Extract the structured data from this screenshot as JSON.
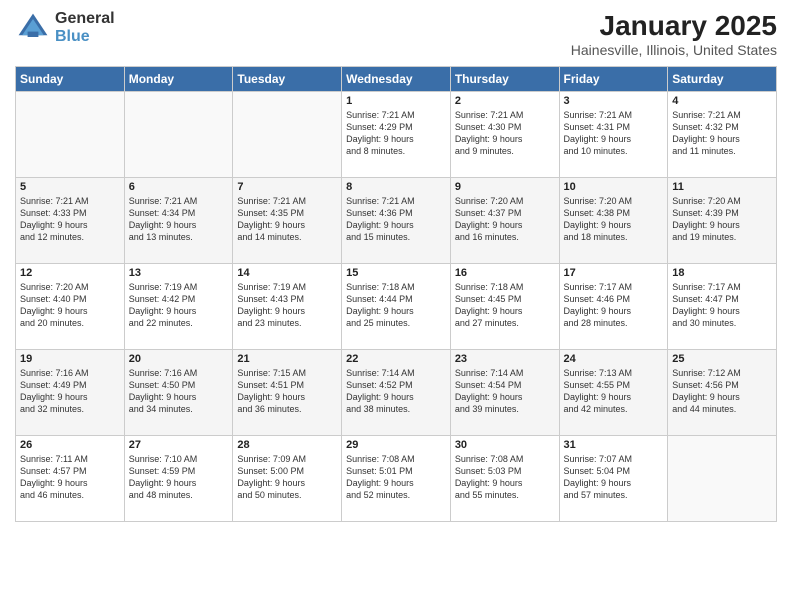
{
  "logo": {
    "line1": "General",
    "line2": "Blue"
  },
  "title": "January 2025",
  "subtitle": "Hainesville, Illinois, United States",
  "headers": [
    "Sunday",
    "Monday",
    "Tuesday",
    "Wednesday",
    "Thursday",
    "Friday",
    "Saturday"
  ],
  "weeks": [
    [
      {
        "day": "",
        "info": ""
      },
      {
        "day": "",
        "info": ""
      },
      {
        "day": "",
        "info": ""
      },
      {
        "day": "1",
        "info": "Sunrise: 7:21 AM\nSunset: 4:29 PM\nDaylight: 9 hours\nand 8 minutes."
      },
      {
        "day": "2",
        "info": "Sunrise: 7:21 AM\nSunset: 4:30 PM\nDaylight: 9 hours\nand 9 minutes."
      },
      {
        "day": "3",
        "info": "Sunrise: 7:21 AM\nSunset: 4:31 PM\nDaylight: 9 hours\nand 10 minutes."
      },
      {
        "day": "4",
        "info": "Sunrise: 7:21 AM\nSunset: 4:32 PM\nDaylight: 9 hours\nand 11 minutes."
      }
    ],
    [
      {
        "day": "5",
        "info": "Sunrise: 7:21 AM\nSunset: 4:33 PM\nDaylight: 9 hours\nand 12 minutes."
      },
      {
        "day": "6",
        "info": "Sunrise: 7:21 AM\nSunset: 4:34 PM\nDaylight: 9 hours\nand 13 minutes."
      },
      {
        "day": "7",
        "info": "Sunrise: 7:21 AM\nSunset: 4:35 PM\nDaylight: 9 hours\nand 14 minutes."
      },
      {
        "day": "8",
        "info": "Sunrise: 7:21 AM\nSunset: 4:36 PM\nDaylight: 9 hours\nand 15 minutes."
      },
      {
        "day": "9",
        "info": "Sunrise: 7:20 AM\nSunset: 4:37 PM\nDaylight: 9 hours\nand 16 minutes."
      },
      {
        "day": "10",
        "info": "Sunrise: 7:20 AM\nSunset: 4:38 PM\nDaylight: 9 hours\nand 18 minutes."
      },
      {
        "day": "11",
        "info": "Sunrise: 7:20 AM\nSunset: 4:39 PM\nDaylight: 9 hours\nand 19 minutes."
      }
    ],
    [
      {
        "day": "12",
        "info": "Sunrise: 7:20 AM\nSunset: 4:40 PM\nDaylight: 9 hours\nand 20 minutes."
      },
      {
        "day": "13",
        "info": "Sunrise: 7:19 AM\nSunset: 4:42 PM\nDaylight: 9 hours\nand 22 minutes."
      },
      {
        "day": "14",
        "info": "Sunrise: 7:19 AM\nSunset: 4:43 PM\nDaylight: 9 hours\nand 23 minutes."
      },
      {
        "day": "15",
        "info": "Sunrise: 7:18 AM\nSunset: 4:44 PM\nDaylight: 9 hours\nand 25 minutes."
      },
      {
        "day": "16",
        "info": "Sunrise: 7:18 AM\nSunset: 4:45 PM\nDaylight: 9 hours\nand 27 minutes."
      },
      {
        "day": "17",
        "info": "Sunrise: 7:17 AM\nSunset: 4:46 PM\nDaylight: 9 hours\nand 28 minutes."
      },
      {
        "day": "18",
        "info": "Sunrise: 7:17 AM\nSunset: 4:47 PM\nDaylight: 9 hours\nand 30 minutes."
      }
    ],
    [
      {
        "day": "19",
        "info": "Sunrise: 7:16 AM\nSunset: 4:49 PM\nDaylight: 9 hours\nand 32 minutes."
      },
      {
        "day": "20",
        "info": "Sunrise: 7:16 AM\nSunset: 4:50 PM\nDaylight: 9 hours\nand 34 minutes."
      },
      {
        "day": "21",
        "info": "Sunrise: 7:15 AM\nSunset: 4:51 PM\nDaylight: 9 hours\nand 36 minutes."
      },
      {
        "day": "22",
        "info": "Sunrise: 7:14 AM\nSunset: 4:52 PM\nDaylight: 9 hours\nand 38 minutes."
      },
      {
        "day": "23",
        "info": "Sunrise: 7:14 AM\nSunset: 4:54 PM\nDaylight: 9 hours\nand 39 minutes."
      },
      {
        "day": "24",
        "info": "Sunrise: 7:13 AM\nSunset: 4:55 PM\nDaylight: 9 hours\nand 42 minutes."
      },
      {
        "day": "25",
        "info": "Sunrise: 7:12 AM\nSunset: 4:56 PM\nDaylight: 9 hours\nand 44 minutes."
      }
    ],
    [
      {
        "day": "26",
        "info": "Sunrise: 7:11 AM\nSunset: 4:57 PM\nDaylight: 9 hours\nand 46 minutes."
      },
      {
        "day": "27",
        "info": "Sunrise: 7:10 AM\nSunset: 4:59 PM\nDaylight: 9 hours\nand 48 minutes."
      },
      {
        "day": "28",
        "info": "Sunrise: 7:09 AM\nSunset: 5:00 PM\nDaylight: 9 hours\nand 50 minutes."
      },
      {
        "day": "29",
        "info": "Sunrise: 7:08 AM\nSunset: 5:01 PM\nDaylight: 9 hours\nand 52 minutes."
      },
      {
        "day": "30",
        "info": "Sunrise: 7:08 AM\nSunset: 5:03 PM\nDaylight: 9 hours\nand 55 minutes."
      },
      {
        "day": "31",
        "info": "Sunrise: 7:07 AM\nSunset: 5:04 PM\nDaylight: 9 hours\nand 57 minutes."
      },
      {
        "day": "",
        "info": ""
      }
    ]
  ]
}
